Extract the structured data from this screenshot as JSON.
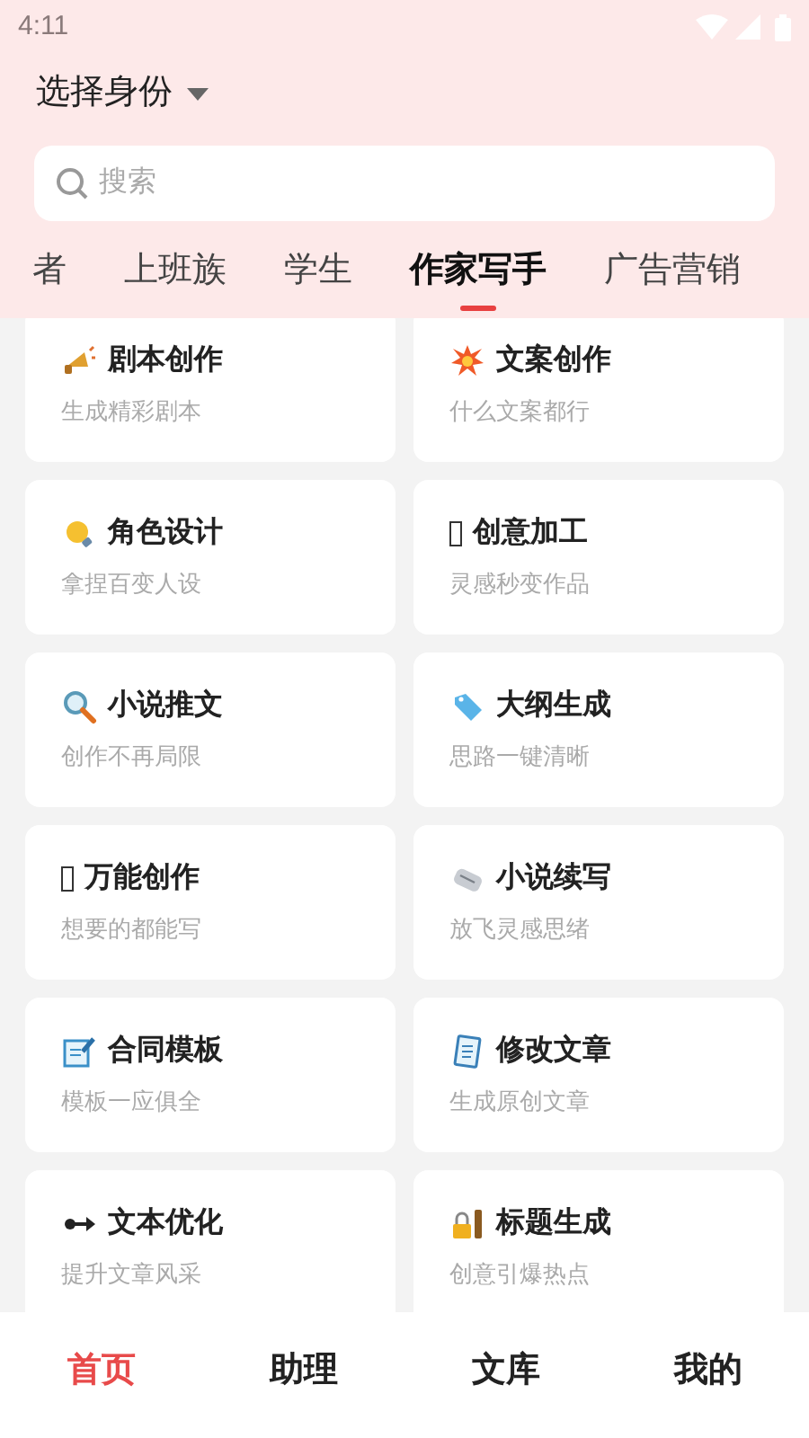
{
  "status_bar": {
    "time": "4:11"
  },
  "header": {
    "title": "选择身份"
  },
  "search": {
    "placeholder": "搜索"
  },
  "tabs": [
    {
      "label": "者",
      "selected": false
    },
    {
      "label": "上班族",
      "selected": false
    },
    {
      "label": "学生",
      "selected": false
    },
    {
      "label": "作家写手",
      "selected": true
    },
    {
      "label": "广告营销",
      "selected": false
    }
  ],
  "cards": [
    {
      "title": "剧本创作",
      "subtitle": "生成精彩剧本"
    },
    {
      "title": "文案创作",
      "subtitle": "什么文案都行"
    },
    {
      "title": "角色设计",
      "subtitle": "拿捏百变人设"
    },
    {
      "title": "创意加工",
      "subtitle": "灵感秒变作品"
    },
    {
      "title": "小说推文",
      "subtitle": "创作不再局限"
    },
    {
      "title": "大纲生成",
      "subtitle": "思路一键清晰"
    },
    {
      "title": "万能创作",
      "subtitle": "想要的都能写"
    },
    {
      "title": "小说续写",
      "subtitle": "放飞灵感思绪"
    },
    {
      "title": "合同模板",
      "subtitle": "模板一应俱全"
    },
    {
      "title": "修改文章",
      "subtitle": "生成原创文章"
    },
    {
      "title": "文本优化",
      "subtitle": "提升文章风采"
    },
    {
      "title": "标题生成",
      "subtitle": "创意引爆热点"
    }
  ],
  "bottom_nav": [
    {
      "label": "首页",
      "selected": true
    },
    {
      "label": "助理",
      "selected": false
    },
    {
      "label": "文库",
      "selected": false
    },
    {
      "label": "我的",
      "selected": false
    }
  ]
}
